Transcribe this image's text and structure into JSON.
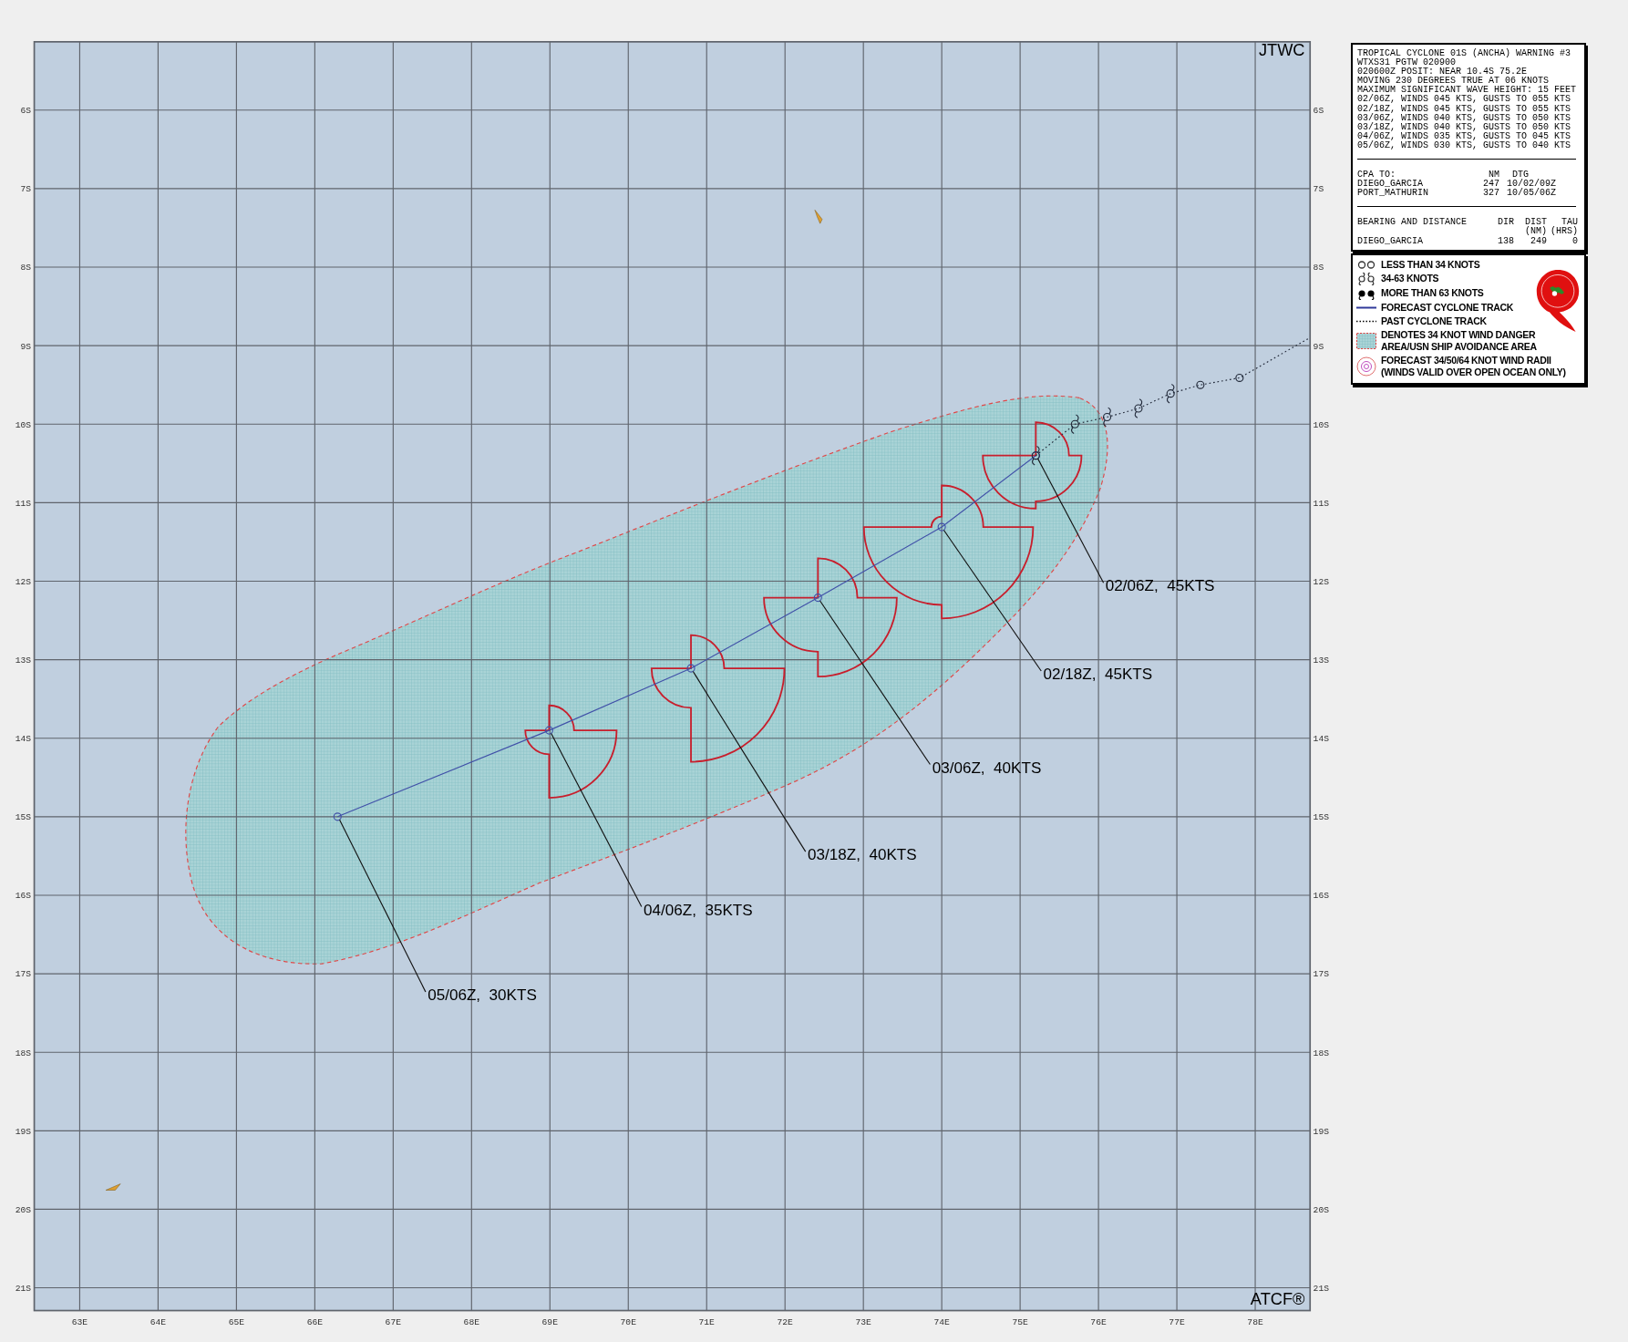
{
  "map": {
    "corner_labels": {
      "top": "JTWC",
      "bottom": "ATCF®"
    },
    "chart_data": {
      "type": "line",
      "grid": true,
      "xlim": [
        62.42,
        78.7
      ],
      "ylim": [
        -21.29,
        -5.13
      ],
      "xticks": [
        {
          "value": 63,
          "label": "63E"
        },
        {
          "value": 64,
          "label": "64E"
        },
        {
          "value": 65,
          "label": "65E"
        },
        {
          "value": 66,
          "label": "66E"
        },
        {
          "value": 67,
          "label": "67E"
        },
        {
          "value": 68,
          "label": "68E"
        },
        {
          "value": 69,
          "label": "69E"
        },
        {
          "value": 70,
          "label": "70E"
        },
        {
          "value": 71,
          "label": "71E"
        },
        {
          "value": 72,
          "label": "72E"
        },
        {
          "value": 73,
          "label": "73E"
        },
        {
          "value": 74,
          "label": "74E"
        },
        {
          "value": 75,
          "label": "75E"
        },
        {
          "value": 76,
          "label": "76E"
        },
        {
          "value": 77,
          "label": "77E"
        },
        {
          "value": 78,
          "label": "78E"
        }
      ],
      "yticks": [
        {
          "value": -6,
          "label": "6S"
        },
        {
          "value": -7,
          "label": "7S"
        },
        {
          "value": -8,
          "label": "8S"
        },
        {
          "value": -9,
          "label": "9S"
        },
        {
          "value": -10,
          "label": "10S"
        },
        {
          "value": -11,
          "label": "11S"
        },
        {
          "value": -12,
          "label": "12S"
        },
        {
          "value": -13,
          "label": "13S"
        },
        {
          "value": -14,
          "label": "14S"
        },
        {
          "value": -15,
          "label": "15S"
        },
        {
          "value": -16,
          "label": "16S"
        },
        {
          "value": -17,
          "label": "17S"
        },
        {
          "value": -18,
          "label": "18S"
        },
        {
          "value": -19,
          "label": "19S"
        },
        {
          "value": -20,
          "label": "20S"
        },
        {
          "value": -21,
          "label": "21S"
        }
      ],
      "series": [
        {
          "name": "FORECAST CYCLONE TRACK",
          "color": "#4050a8",
          "line_style": "solid",
          "marker": "circle",
          "x": [
            75.2,
            74.0,
            72.42,
            70.8,
            68.99,
            66.29
          ],
          "values": [
            -10.4,
            -11.31,
            -12.21,
            -13.11,
            -13.9,
            -15.0
          ]
        },
        {
          "name": "PAST CYCLONE TRACK",
          "color": "#202838",
          "line_style": "dotted",
          "marker": "circle",
          "x": [
            75.2,
            75.7,
            76.11,
            76.51,
            76.92,
            77.3,
            77.8,
            78.68
          ],
          "values": [
            -10.4,
            -10.0,
            -9.91,
            -9.8,
            -9.61,
            -9.5,
            -9.41,
            -8.91
          ]
        }
      ],
      "annotations": [
        {
          "text": "02/06Z,  45KTS"
        },
        {
          "text": "02/18Z,  45KTS"
        },
        {
          "text": "03/06Z,  40KTS"
        },
        {
          "text": "03/18Z,  40KTS"
        },
        {
          "text": "04/06Z,  35KTS"
        },
        {
          "text": "05/06Z,  30KTS"
        }
      ]
    },
    "right_axis_labels": [
      "6S",
      "7S",
      "8S",
      "9S",
      "10S",
      "11S",
      "12S",
      "13S",
      "14S",
      "15S",
      "16S",
      "17S",
      "18S",
      "19S",
      "20S",
      "21S"
    ]
  },
  "warning": {
    "lines": [
      "TROPICAL CYCLONE 01S (ANCHA) WARNING #3",
      "WTXS31 PGTW 020900",
      "020600Z POSIT: NEAR 10.4S 75.2E",
      "MOVING 230 DEGREES TRUE AT 06 KNOTS",
      "MAXIMUM SIGNIFICANT WAVE HEIGHT: 15 FEET",
      "02/06Z, WINDS 045 KTS, GUSTS TO 055 KTS",
      "02/18Z, WINDS 045 KTS, GUSTS TO 055 KTS",
      "03/06Z, WINDS 040 KTS, GUSTS TO 050 KTS",
      "03/18Z, WINDS 040 KTS, GUSTS TO 050 KTS",
      "04/06Z, WINDS 035 KTS, GUSTS TO 045 KTS",
      "05/06Z, WINDS 030 KTS, GUSTS TO 040 KTS"
    ],
    "cpa": {
      "columns": [
        "CPA TO:",
        "NM",
        "DTG"
      ],
      "rows": [
        [
          "DIEGO_GARCIA",
          "247",
          "10/02/09Z"
        ],
        [
          "PORT_MATHURIN",
          "327",
          "10/05/06Z"
        ]
      ]
    },
    "bearing": {
      "columns": [
        "BEARING AND DISTANCE",
        "DIR",
        "DIST",
        "TAU"
      ],
      "units": [
        "(NM)",
        "(HRS)"
      ],
      "rows": [
        [
          "DIEGO_GARCIA",
          "138",
          "249",
          "0"
        ]
      ]
    }
  },
  "legend": {
    "items": [
      {
        "kind": "below34",
        "lines": [
          "LESS THAN 34 KNOTS"
        ]
      },
      {
        "kind": "storm",
        "lines": [
          "34-63 KNOTS"
        ]
      },
      {
        "kind": "above63",
        "lines": [
          "MORE THAN 63 KNOTS"
        ]
      },
      {
        "kind": "forecast_track"
      },
      {
        "kind": "past_track"
      },
      {
        "kind": "danger_area",
        "lines": [
          "DENOTES 34 KNOT WIND DANGER",
          "AREA/USN SHIP AVOIDANCE AREA"
        ]
      },
      {
        "kind": "wind_radii",
        "lines": [
          "FORECAST 34/50/64 KNOT WIND RADII",
          "(WINDS VALID OVER OPEN OCEAN ONLY)"
        ]
      }
    ]
  }
}
